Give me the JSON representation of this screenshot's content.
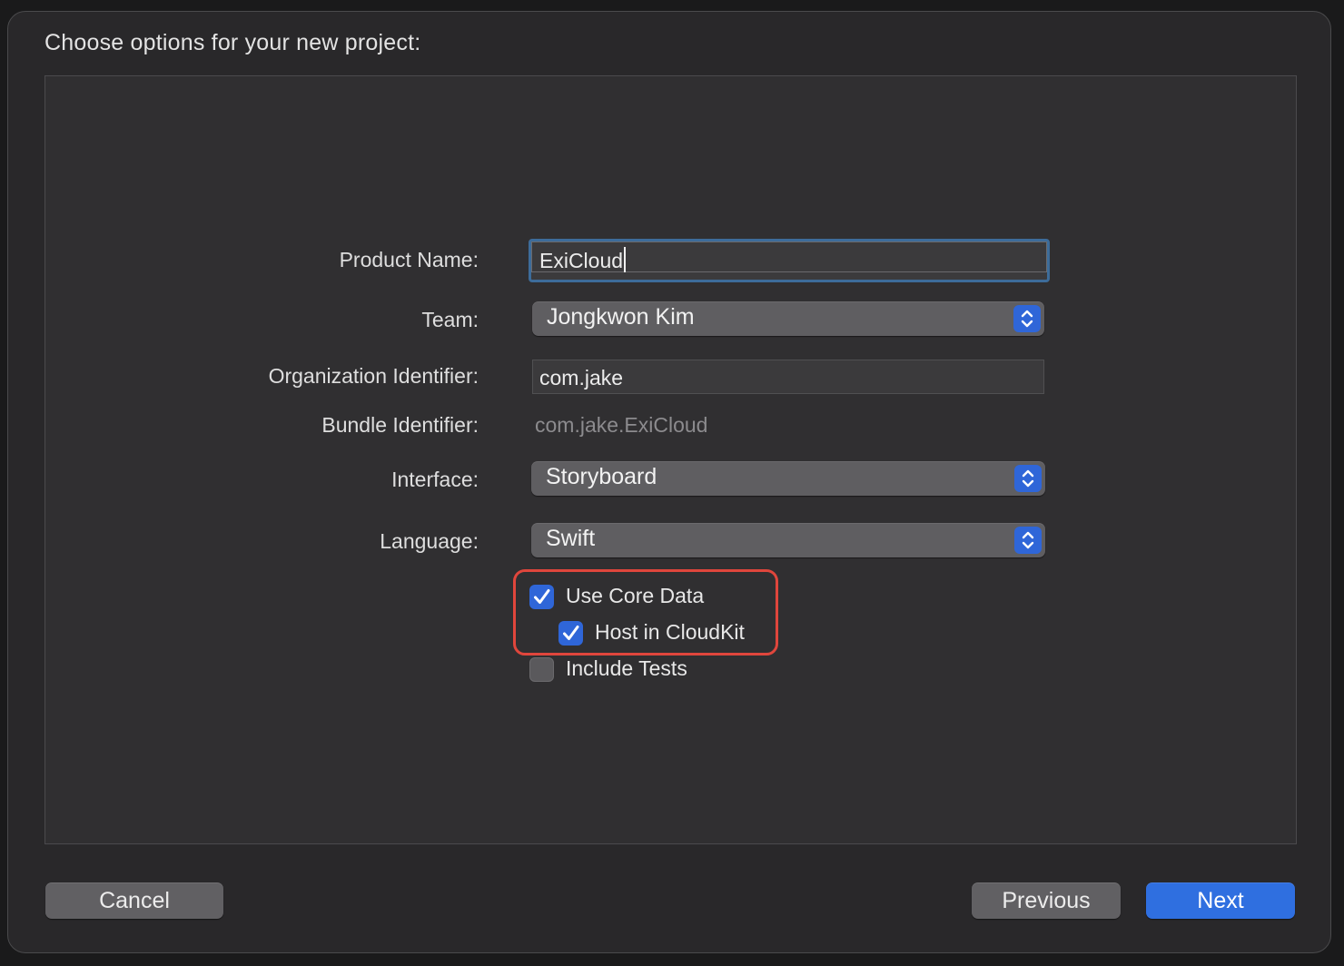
{
  "dialog": {
    "title": "Choose options for your new project:"
  },
  "form": {
    "product_name": {
      "label": "Product Name:",
      "value": "ExiCloud"
    },
    "team": {
      "label": "Team:",
      "value": "Jongkwon Kim"
    },
    "organization_identifier": {
      "label": "Organization Identifier:",
      "value": "com.jake"
    },
    "bundle_identifier": {
      "label": "Bundle Identifier:",
      "value": "com.jake.ExiCloud"
    },
    "interface": {
      "label": "Interface:",
      "value": "Storyboard"
    },
    "language": {
      "label": "Language:",
      "value": "Swift"
    },
    "options": [
      {
        "label": "Use Core Data",
        "checked": true
      },
      {
        "label": "Host in CloudKit",
        "checked": true
      },
      {
        "label": "Include Tests",
        "checked": false
      }
    ]
  },
  "buttons": {
    "cancel": "Cancel",
    "previous": "Previous",
    "next": "Next"
  },
  "colors": {
    "accent": "#2f66d8",
    "highlight": "#e0463c",
    "window_bg": "#29282a",
    "panel_bg": "#302f31"
  },
  "icons": {
    "popup_arrows": "chevron-up-down-icon",
    "checkmark": "checkmark-icon"
  }
}
